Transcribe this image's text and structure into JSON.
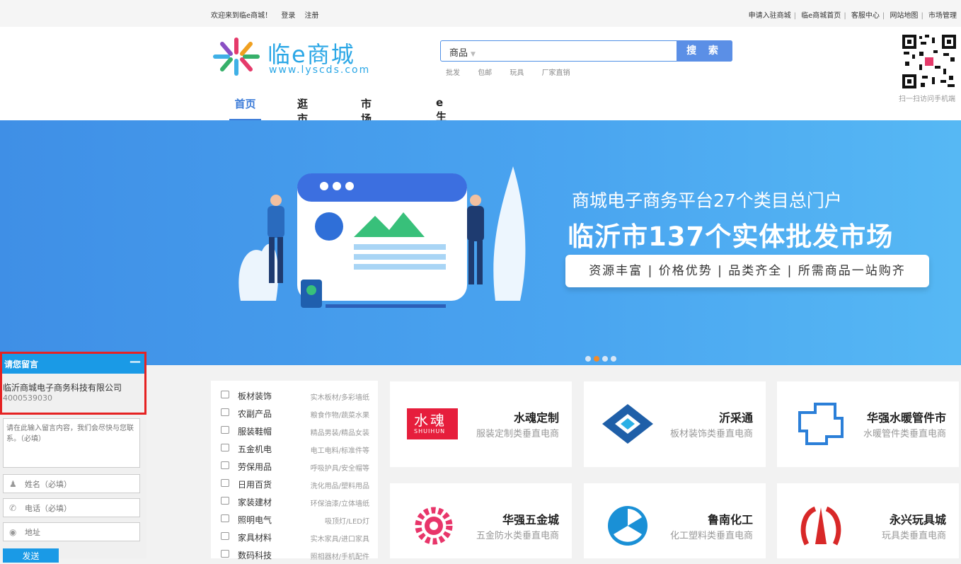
{
  "topbar": {
    "welcome": "欢迎来到临e商城！",
    "login": "登录",
    "register": "注册",
    "links": [
      "申请入驻商城",
      "临e商城首页",
      "客服中心",
      "网站地图",
      "市场管理"
    ]
  },
  "logo": {
    "name": "临e商城",
    "url": "www.lyscds.com"
  },
  "search": {
    "category": "商品",
    "placeholder": "",
    "button": "搜 索",
    "hotwords": [
      "批发",
      "包邮",
      "玩具",
      "厂家直销"
    ]
  },
  "qr": {
    "caption": "扫一扫访问手机端"
  },
  "nav": [
    {
      "label": "首页",
      "active": true
    },
    {
      "label": "逛市场",
      "active": false
    },
    {
      "label": "市场导航",
      "active": false
    },
    {
      "label": "e生活",
      "active": false
    }
  ],
  "banner": {
    "line1": "商城电子商务平台27个类目总门户",
    "line2": "临沂市137个实体批发市场",
    "pill": "资源丰富 | 价格优势 | 品类齐全 | 所需商品一站购齐",
    "dots": 4,
    "active_dot": 2
  },
  "categories": [
    {
      "name": "板材装饰",
      "sub": "实木板材/多彩墙纸"
    },
    {
      "name": "农副产品",
      "sub": "粮食作物/蔬菜水果"
    },
    {
      "name": "服装鞋帽",
      "sub": "精品男装/精品女装"
    },
    {
      "name": "五金机电",
      "sub": "电工电料/标准件等"
    },
    {
      "name": "劳保用品",
      "sub": "呼吸护具/安全帽等"
    },
    {
      "name": "日用百货",
      "sub": "洗化用品/塑料用品"
    },
    {
      "name": "家装建材",
      "sub": "环保油漆/立体墙纸"
    },
    {
      "name": "照明电气",
      "sub": "吸顶灯/LED灯"
    },
    {
      "name": "家具材料",
      "sub": "实木家具/进口家具"
    },
    {
      "name": "数码科技",
      "sub": "照相器材/手机配件"
    }
  ],
  "shops": [
    {
      "title": "水魂定制",
      "desc": "服装定制类垂直电商",
      "logo_text": "水魂",
      "logo_sub": "SHUIHUN"
    },
    {
      "title": "沂采通",
      "desc": "板材装饰类垂直电商"
    },
    {
      "title": "华强水暖管件市",
      "desc": "水暖管件类垂直电商"
    },
    {
      "title": "华强五金城",
      "desc": "五金防水类垂直电商"
    },
    {
      "title": "鲁南化工",
      "desc": "化工塑料类垂直电商"
    },
    {
      "title": "永兴玩具城",
      "desc": "玩具类垂直电商"
    }
  ],
  "message": {
    "header": "请您留言",
    "minimize": "—",
    "company": "临沂商城电子商务科技有限公司",
    "phone": "4000539030",
    "content_placeholder": "请在此输入留言内容，我们会尽快与您联系。（必填）",
    "name_placeholder": "姓名（必填）",
    "tel_placeholder": "电话（必填）",
    "addr_placeholder": "地址",
    "send": "发送"
  },
  "colors": {
    "accent": "#3d7cd8",
    "widget": "#1a9ae6",
    "highlight": "#e52222",
    "dot_active": "#f18b2b"
  }
}
